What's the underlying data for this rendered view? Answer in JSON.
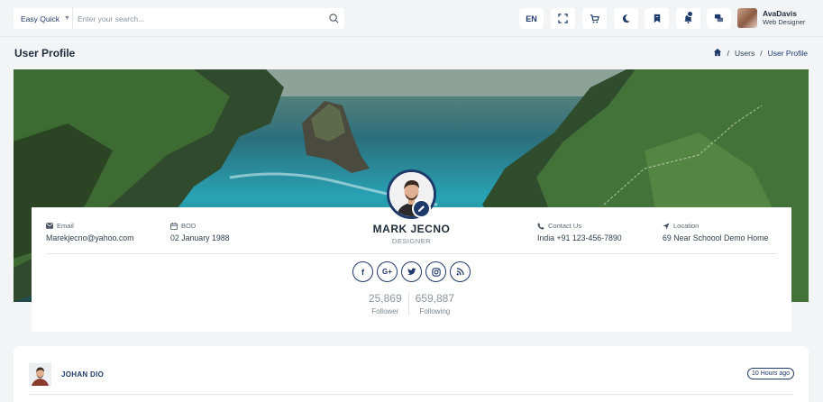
{
  "topbar": {
    "search_category": "Easy Quick",
    "search_placeholder": "Enter your search...",
    "language": "EN",
    "user": {
      "name": "AvaDavis",
      "role": "Web Designer"
    }
  },
  "page": {
    "title": "User Profile",
    "breadcrumb": [
      "Users",
      "User Profile"
    ]
  },
  "profile": {
    "name": "MARK JECNO",
    "role": "DESIGNER",
    "email_label": "Email",
    "email": "Marekjecno@yahoo.com",
    "bod_label": "BOD",
    "bod": "02 January 1988",
    "contact_label": "Contact Us",
    "contact": "India +91 123-456-7890",
    "location_label": "Location",
    "location": "69 Near Schoool Demo Home",
    "socials": [
      "f",
      "G+"
    ],
    "follower_count": "25,869",
    "follower_label": "Follower",
    "following_count": "659,887",
    "following_label": "Following"
  },
  "post": {
    "author": "JOHAN DIO",
    "time": "10 Hours ago"
  },
  "colors": {
    "accent": "#1e3a6b",
    "background": "#f3f4f6"
  }
}
